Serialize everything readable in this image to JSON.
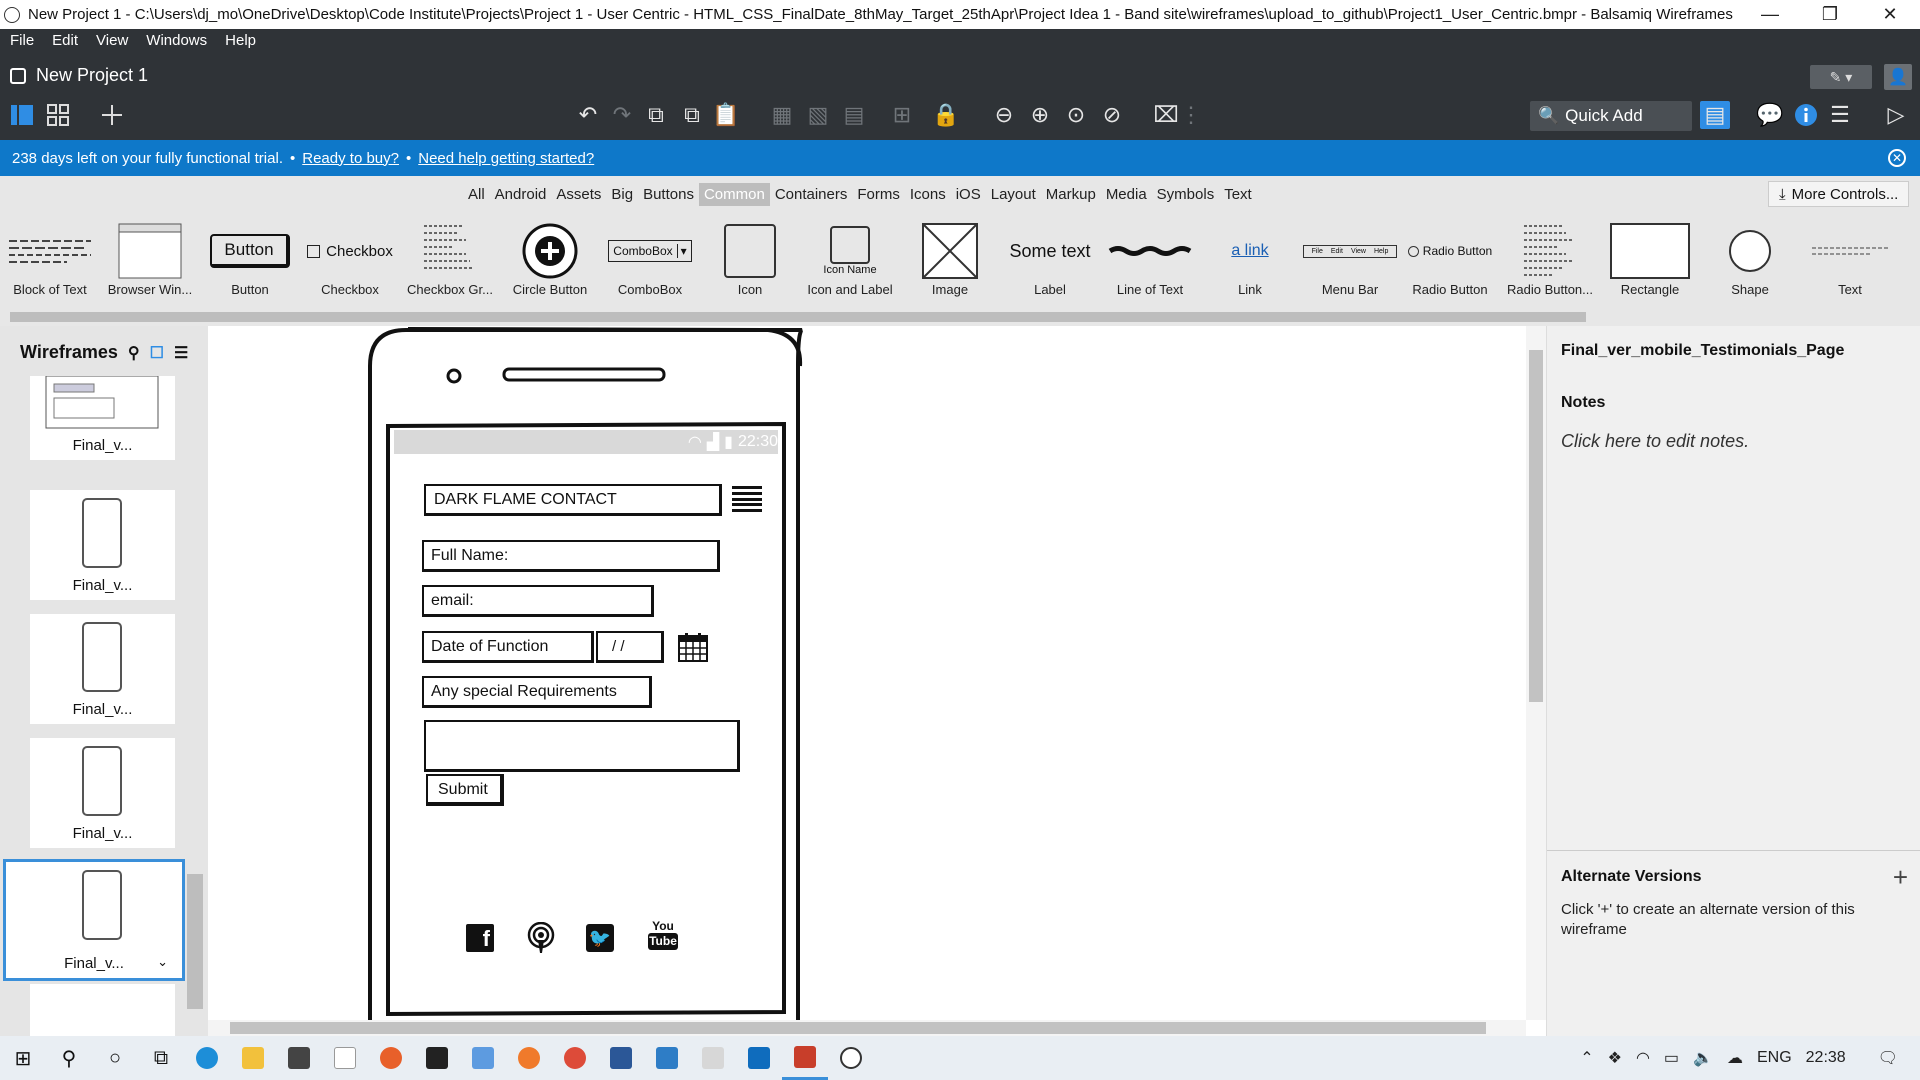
{
  "window": {
    "title": "New Project 1 - C:\\Users\\dj_mo\\OneDrive\\Desktop\\Code Institute\\Projects\\Project 1 - User Centric - HTML_CSS_FinalDate_8thMay_Target_25thApr\\Project Idea 1 - Band site\\wireframes\\upload_to_github\\Project1_User_Centric.bmpr - Balsamiq Wireframes",
    "minimize": "—",
    "maximize": "❐",
    "close": "✕"
  },
  "menu": [
    "File",
    "Edit",
    "View",
    "Windows",
    "Help"
  ],
  "project": {
    "name": "New Project 1"
  },
  "toolbar": {
    "quick_add": "Quick Add",
    "icons": [
      "list-view-icon",
      "grid-view-icon",
      "add-icon",
      "undo-icon",
      "redo-icon",
      "copy-icon",
      "duplicate-icon",
      "paste-icon",
      "group-icon",
      "ungroup-icon",
      "align-icon",
      "arrange-icon",
      "lock-icon",
      "zoom-out-icon",
      "zoom-in-icon",
      "actual-size-icon",
      "zoom-fit-icon",
      "delete-icon"
    ]
  },
  "trial": {
    "text": "238 days left on your fully functional trial.",
    "sep": "•",
    "buy": "Ready to buy?",
    "help": "Need help getting started?"
  },
  "categories": {
    "items": [
      "All",
      "Android",
      "Assets",
      "Big",
      "Buttons",
      "Common",
      "Containers",
      "Forms",
      "Icons",
      "iOS",
      "Layout",
      "Markup",
      "Media",
      "Symbols",
      "Text"
    ],
    "active": "Common",
    "more": "More Controls..."
  },
  "library": {
    "items": [
      "Block of Text",
      "Browser Win...",
      "Button",
      "Checkbox",
      "Checkbox Gr...",
      "Circle Button",
      "ComboBox",
      "Icon",
      "Icon and Label",
      "Image",
      "Label",
      "Line of Text",
      "Link",
      "Menu Bar",
      "Radio Button",
      "Radio Button...",
      "Rectangle",
      "Shape",
      "Text"
    ],
    "previews": {
      "button": "Button",
      "checkbox": "Checkbox",
      "combobox": "ComboBox",
      "icon_name": "Icon Name",
      "label": "Some text",
      "link": "a link",
      "radio": "Radio Button",
      "menu": [
        "File",
        "Edit",
        "View",
        "Help"
      ]
    }
  },
  "wireframes": {
    "title": "Wireframes",
    "thumbs": [
      "Final_v...",
      "Final_v...",
      "Final_v...",
      "Final_v...",
      "Final_v..."
    ]
  },
  "mockup": {
    "status_time": "22:30",
    "header": "DARK FLAME CONTACT",
    "full_name": "Full Name:",
    "email": "email:",
    "date_label": "Date of Function",
    "date_value": "/  /",
    "requirements": "Any special Requirements",
    "submit": "Submit",
    "social": [
      "facebook-icon",
      "podcast-icon",
      "twitter-icon",
      "youtube-icon"
    ],
    "youtube_top": "You",
    "youtube_bottom": "Tube"
  },
  "inspector": {
    "page_name": "Final_ver_mobile_Testimonials_Page",
    "notes_title": "Notes",
    "notes_placeholder": "Click here to edit notes.",
    "alt_title": "Alternate Versions",
    "alt_plus": "+",
    "alt_body": "Click '+' to create an alternate version of this wireframe"
  },
  "taskbar": {
    "lang": "ENG",
    "time": "22:38",
    "apps": [
      "edge",
      "file-explorer",
      "store",
      "notepad",
      "firefox",
      "notion",
      "photos",
      "app-orange",
      "chrome",
      "word",
      "image-viewer",
      "paint",
      "mail",
      "balsamiq",
      "face"
    ]
  }
}
